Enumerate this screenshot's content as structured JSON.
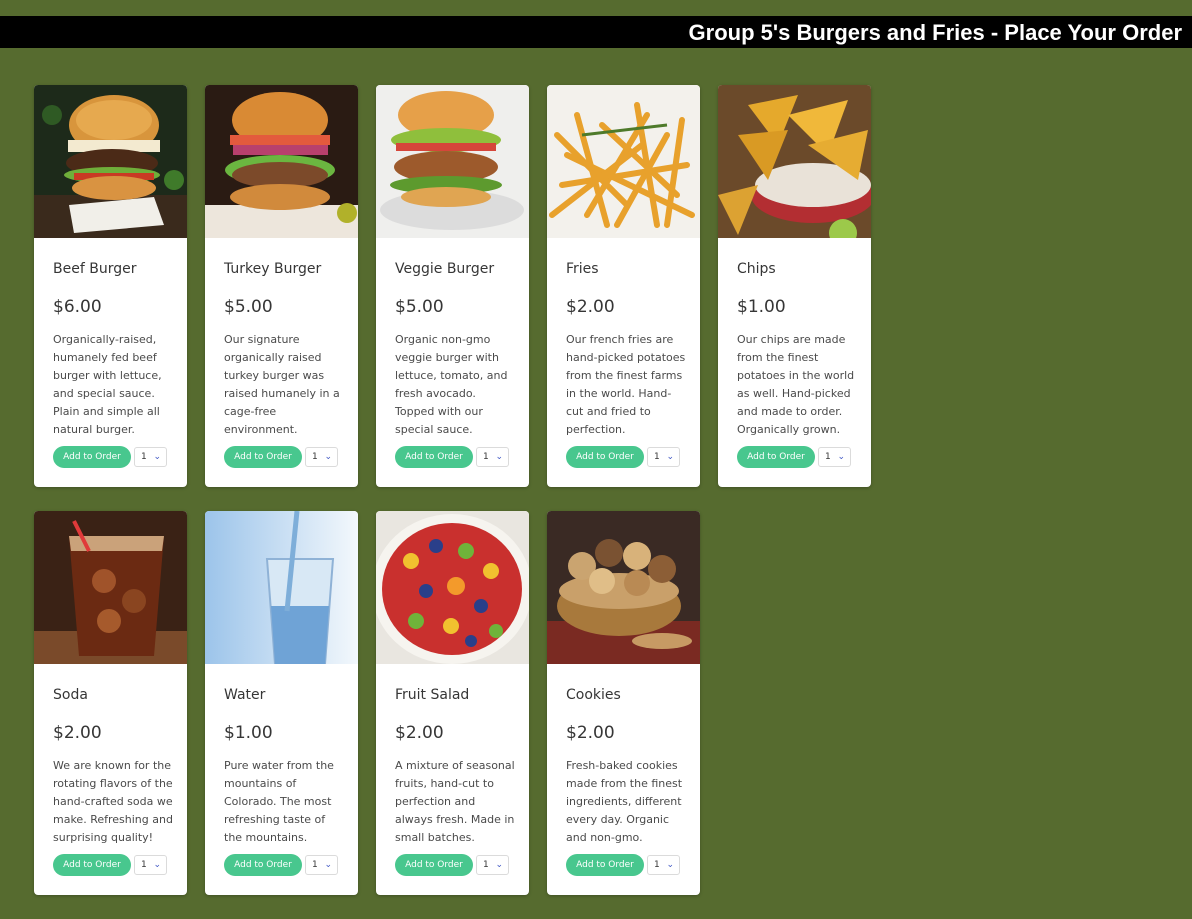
{
  "header": {
    "title": "Group 5's Burgers and Fries - Place Your Order"
  },
  "items": [
    {
      "name": "Beef Burger",
      "price": "$6.00",
      "description": "Organically-raised, humanely fed beef burger with lettuce, and special sauce. Plain and simple all natural burger.",
      "button": "Add to Order",
      "qty": "1"
    },
    {
      "name": "Turkey Burger",
      "price": "$5.00",
      "description": "Our signature organically raised turkey burger was raised humanely in a cage-free environment.",
      "button": "Add to Order",
      "qty": "1"
    },
    {
      "name": "Veggie Burger",
      "price": "$5.00",
      "description": "Organic non-gmo veggie burger with lettuce, tomato, and fresh avocado. Topped with our special sauce.",
      "button": "Add to Order",
      "qty": "1"
    },
    {
      "name": "Fries",
      "price": "$2.00",
      "description": "Our french fries are hand-picked potatoes from the finest farms in the world. Hand-cut and fried to perfection.",
      "button": "Add to Order",
      "qty": "1"
    },
    {
      "name": "Chips",
      "price": "$1.00",
      "description": "Our chips are made from the finest potatoes in the world as well. Hand-picked and made to order. Organically grown.",
      "button": "Add to Order",
      "qty": "1"
    },
    {
      "name": "Soda",
      "price": "$2.00",
      "description": "We are known for the rotating flavors of the hand-crafted soda we make. Refreshing and surprising quality!",
      "button": "Add to Order",
      "qty": "1"
    },
    {
      "name": "Water",
      "price": "$1.00",
      "description": "Pure water from the mountains of Colorado. The most refreshing taste of the mountains.",
      "button": "Add to Order",
      "qty": "1"
    },
    {
      "name": "Fruit Salad",
      "price": "$2.00",
      "description": "A mixture of seasonal fruits, hand-cut to perfection and always fresh. Made in small batches.",
      "button": "Add to Order",
      "qty": "1"
    },
    {
      "name": "Cookies",
      "price": "$2.00",
      "description": "Fresh-baked cookies made from the finest ingredients, different every day. Organic and non-gmo.",
      "button": "Add to Order",
      "qty": "1"
    }
  ],
  "colors": {
    "background": "#566b2f",
    "header": "#000000",
    "button": "#48c78e",
    "card": "#ffffff"
  },
  "icons": {
    "qty_chevron": "chevron-down-icon"
  }
}
